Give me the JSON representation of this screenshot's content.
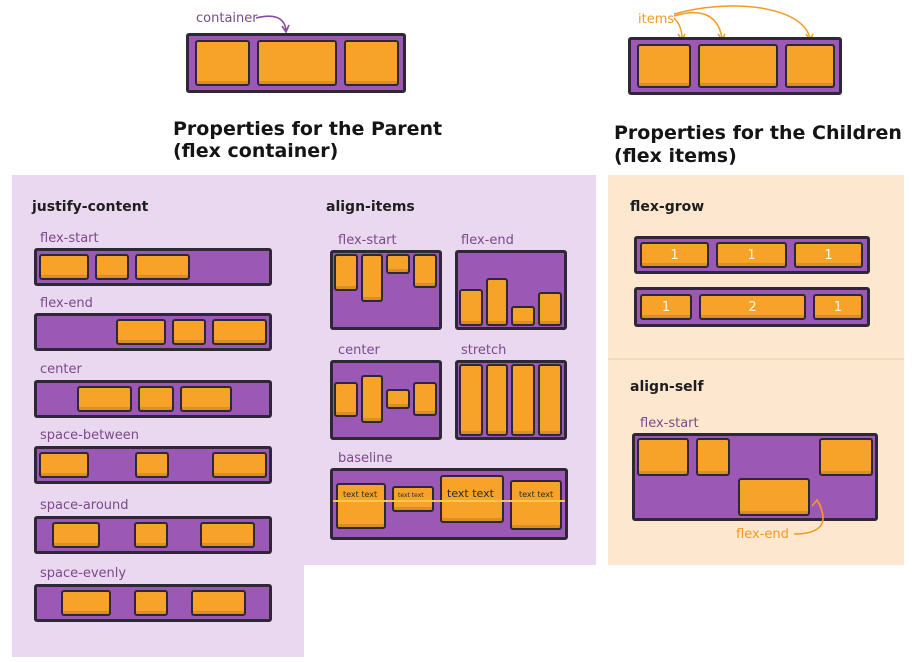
{
  "header": {
    "container_label": "container",
    "items_label": "items",
    "parent_title_line1": "Properties for the Parent",
    "parent_title_line2": "(flex container)",
    "children_title_line1": "Properties for the Children",
    "children_title_line2": "(flex items)"
  },
  "justify_content": {
    "heading": "justify-content",
    "variants": [
      "flex-start",
      "flex-end",
      "center",
      "space-between",
      "space-around",
      "space-evenly"
    ]
  },
  "align_items": {
    "heading": "align-items",
    "variants": [
      "flex-start",
      "flex-end",
      "center",
      "stretch",
      "baseline"
    ],
    "baseline_texts": [
      "text text",
      "text text",
      "text text",
      "text text"
    ]
  },
  "flex_grow": {
    "heading": "flex-grow",
    "row1": [
      "1",
      "1",
      "1"
    ],
    "row2": [
      "1",
      "2",
      "1"
    ]
  },
  "align_self": {
    "heading": "align-self",
    "start_label": "flex-start",
    "end_label": "flex-end"
  },
  "colors": {
    "container": "#9b59b5",
    "item": "#f7a32a",
    "outline": "#2e2836",
    "parent_panel": "#ead7f0",
    "child_panel": "#fde7cf",
    "label_purple": "#7b4a8a",
    "label_orange": "#f49a25"
  }
}
